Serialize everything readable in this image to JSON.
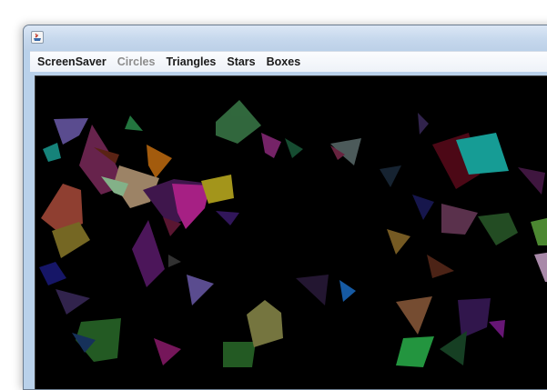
{
  "window": {
    "title": "",
    "icon": "java-app-icon"
  },
  "menu": {
    "items": [
      {
        "label": "ScreenSaver",
        "enabled": true
      },
      {
        "label": "Circles",
        "enabled": false
      },
      {
        "label": "Triangles",
        "enabled": true
      },
      {
        "label": "Stars",
        "enabled": true
      },
      {
        "label": "Boxes",
        "enabled": true
      }
    ]
  },
  "canvas": {
    "background": "#000000",
    "description_colors": [
      "#6a5aa8",
      "#7a2a5a",
      "#c06c10",
      "#2f7a44",
      "#c4269c",
      "#c0b020",
      "#1a9a90",
      "#2aa07a"
    ]
  }
}
